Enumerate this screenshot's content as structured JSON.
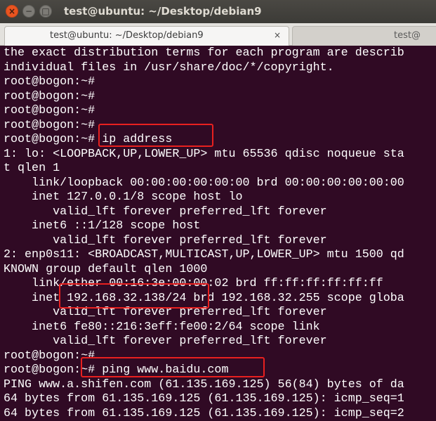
{
  "window": {
    "title": "test@ubuntu: ~/Desktop/debian9",
    "close_glyph": "×",
    "minimize_glyph": "−",
    "maximize_glyph": "□"
  },
  "tabs": [
    {
      "label": "test@ubuntu: ~/Desktop/debian9",
      "close_glyph": "×"
    },
    {
      "label": "test@"
    }
  ],
  "terminal": {
    "lines": [
      "the exact distribution terms for each program are describ",
      "individual files in /usr/share/doc/*/copyright.",
      "root@bogon:~#",
      "root@bogon:~#",
      "root@bogon:~#",
      "root@bogon:~#",
      "root@bogon:~# ip address",
      "1: lo: <LOOPBACK,UP,LOWER_UP> mtu 65536 qdisc noqueue sta",
      "t qlen 1",
      "    link/loopback 00:00:00:00:00:00 brd 00:00:00:00:00:00",
      "    inet 127.0.0.1/8 scope host lo",
      "       valid_lft forever preferred_lft forever",
      "    inet6 ::1/128 scope host",
      "       valid_lft forever preferred_lft forever",
      "2: enp0s11: <BROADCAST,MULTICAST,UP,LOWER_UP> mtu 1500 qd",
      "KNOWN group default qlen 1000",
      "    link/ether 00:16:3e:00:00:02 brd ff:ff:ff:ff:ff:ff",
      "    inet 192.168.32.138/24 brd 192.168.32.255 scope globa",
      "       valid_lft forever preferred_lft forever",
      "    inet6 fe80::216:3eff:fe00:2/64 scope link",
      "       valid_lft forever preferred_lft forever",
      "root@bogon:~#",
      "root@bogon:~# ping www.baidu.com",
      "PING www.a.shifen.com (61.135.169.125) 56(84) bytes of da",
      "64 bytes from 61.135.169.125 (61.135.169.125): icmp_seq=1",
      "64 bytes from 61.135.169.125 (61.135.169.125): icmp_seq=2"
    ]
  },
  "colors": {
    "terminal_bg": "#300a24",
    "terminal_fg": "#ffffff",
    "annotation": "#e8201f",
    "close_button": "#e95420"
  }
}
